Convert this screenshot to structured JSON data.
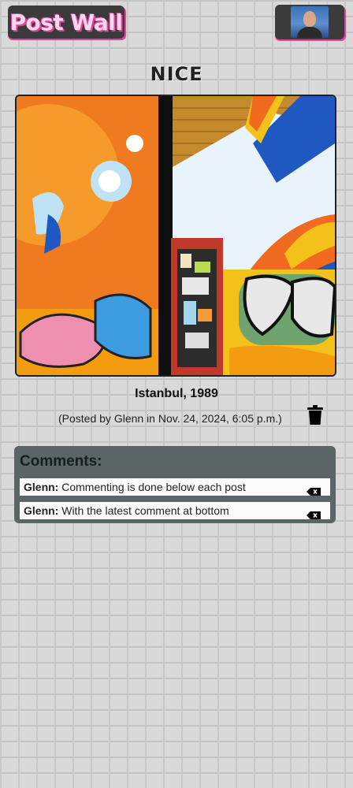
{
  "header": {
    "logo_text": "Post Wall",
    "avatar_icon": "user-avatar"
  },
  "post": {
    "title": "NICE",
    "caption": "Istanbul, 1989",
    "meta": "(Posted by Glenn in Nov. 24, 2024, 6:05 p.m.)",
    "image_icon": "graffiti-photo",
    "delete_icon": "trash-icon"
  },
  "comments": {
    "heading": "Comments:",
    "items": [
      {
        "author": "Glenn:",
        "text": "Commenting is done below each post"
      },
      {
        "author": "Glenn:",
        "text": "With the latest comment at bottom"
      }
    ]
  },
  "colors": {
    "accent": "#e0449a",
    "panel": "#5b6565",
    "background": "#d9d9d9"
  }
}
